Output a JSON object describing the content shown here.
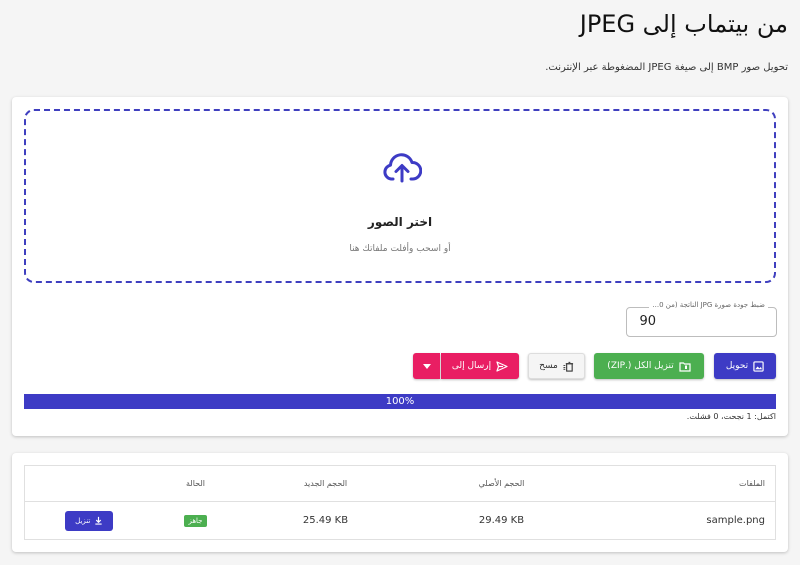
{
  "page": {
    "title": "من بيتماب إلى JPEG",
    "description": "تحويل صور BMP إلى صيغة JPEG المضغوطة عبر الإنترنت."
  },
  "dropzone": {
    "icon": "cloud-upload-icon",
    "title": "اختر الصور",
    "subtitle": "أو اسحب وأفلت ملفاتك هنا"
  },
  "quality": {
    "label": "ضبط جودة صورة JPG الناتجة (من 0...",
    "value": "90"
  },
  "actions": {
    "convert_label": "تحويل",
    "zip_label": "تنزيل الكل (.ZIP)",
    "clear_label": "مسح",
    "send_label": "إرسال إلى"
  },
  "progress": {
    "percent": 100,
    "label": "100%",
    "status": "اكتمل: 1 نجحت، 0 فشلت."
  },
  "table": {
    "headers": {
      "name": "الملفات",
      "original_size": "الحجم الأصلي",
      "new_size": "الحجم الجديد",
      "status": "الحالة",
      "action": ""
    },
    "rows": [
      {
        "name": "sample.png",
        "original_size": "29.49 KB",
        "new_size": "25.49 KB",
        "status": "جاهز",
        "download_label": "تنزيل"
      }
    ]
  },
  "colors": {
    "primary": "#3d3bc5",
    "success": "#4caf50",
    "accent": "#e91e63",
    "background": "#f5f5f5"
  }
}
